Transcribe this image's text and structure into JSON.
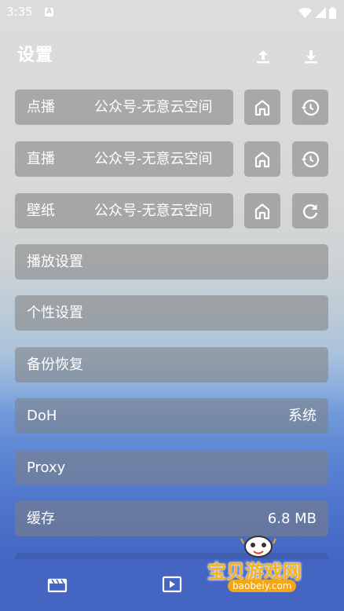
{
  "status_bar": {
    "time": "3:35",
    "notification_icon": "a-icon",
    "wifi_icon": "wifi-icon",
    "signal_icon": "signal-icon",
    "battery_icon": "battery-icon"
  },
  "header": {
    "title": "设置",
    "upload_icon": "upload-icon",
    "download_icon": "download-icon"
  },
  "sources": [
    {
      "label": "点播",
      "value": "公众号-无意云空间",
      "home_icon": "home-icon",
      "action_icon": "history-icon"
    },
    {
      "label": "直播",
      "value": "公众号-无意云空间",
      "home_icon": "home-icon",
      "action_icon": "history-icon"
    },
    {
      "label": "壁纸",
      "value": "公众号-无意云空间",
      "home_icon": "home-icon",
      "action_icon": "refresh-icon"
    }
  ],
  "settings": [
    {
      "label": "播放设置",
      "value": ""
    },
    {
      "label": "个性设置",
      "value": ""
    },
    {
      "label": "备份恢复",
      "value": ""
    },
    {
      "label": "DoH",
      "value": "系统"
    },
    {
      "label": "Proxy",
      "value": ""
    },
    {
      "label": "缓存",
      "value": "6.8 MB"
    }
  ],
  "bottom_nav": {
    "movies_icon": "clapperboard-icon",
    "play_icon": "play-icon"
  },
  "watermark": {
    "text": "宝贝游戏网",
    "url": "baobeiy.com"
  },
  "colors": {
    "row_background": "#8a8a8a",
    "bottom_nav": "#4466c2",
    "watermark_orange": "#f6b11c"
  }
}
